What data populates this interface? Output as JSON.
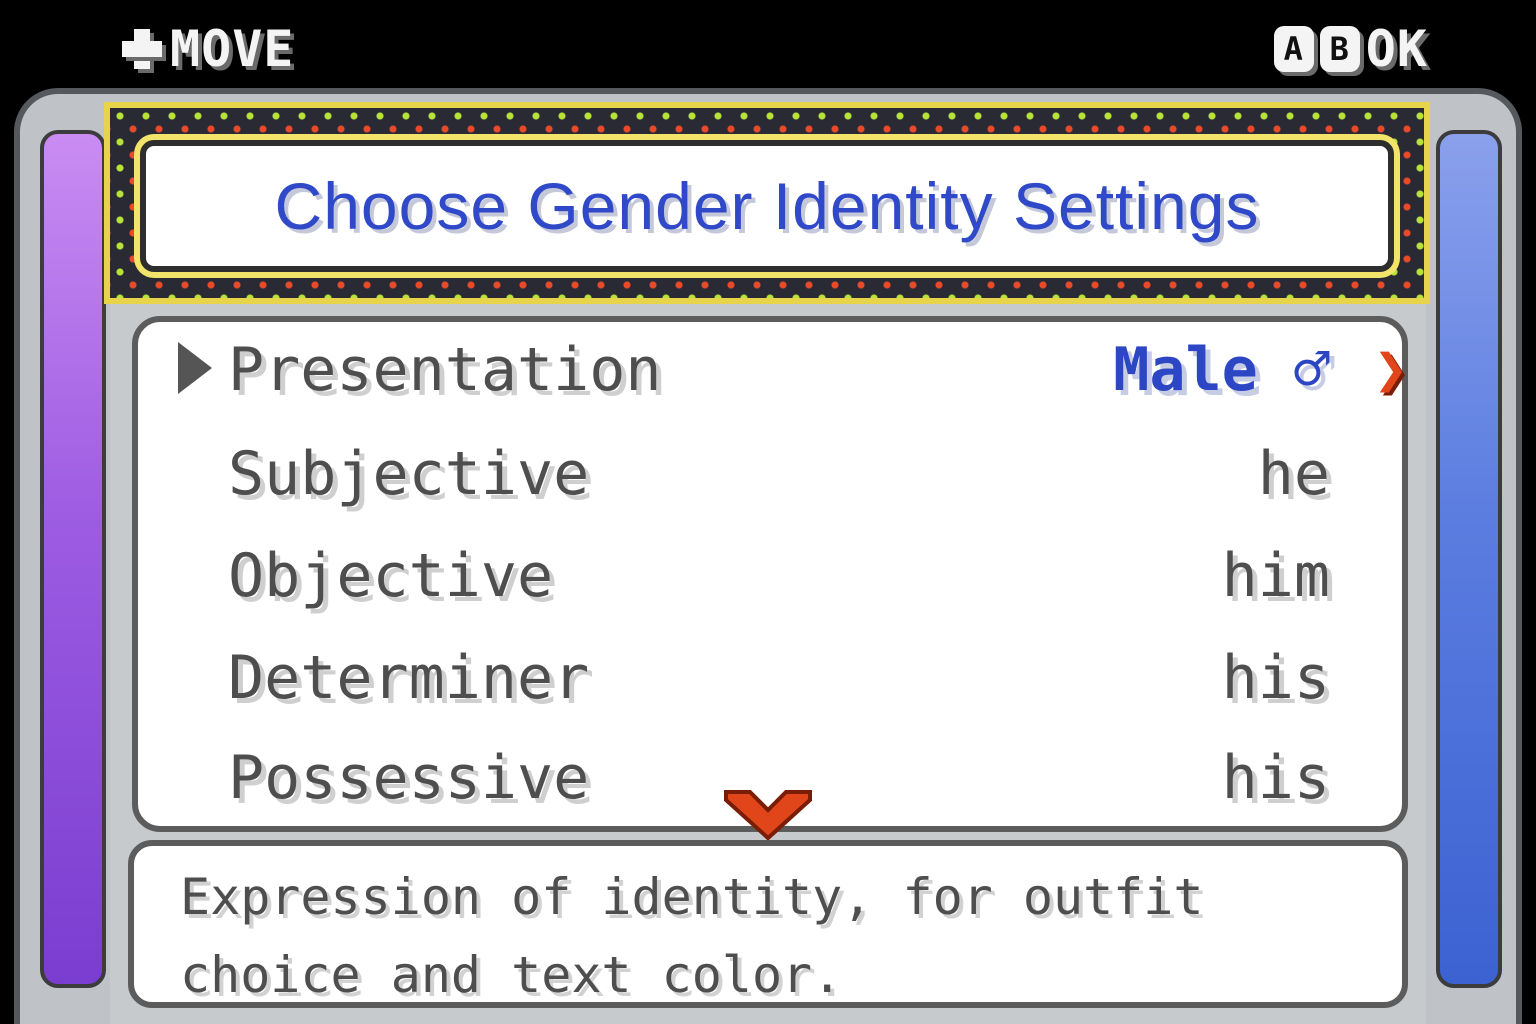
{
  "hints": {
    "move_label": "MOVE",
    "ok_label": "OK",
    "a_button": "A",
    "b_button": "B"
  },
  "title": "Choose Gender Identity Settings",
  "options": [
    {
      "label": "Presentation",
      "value": "Male ♂",
      "selected": true
    },
    {
      "label": "Subjective",
      "value": "he"
    },
    {
      "label": "Objective",
      "value": "him"
    },
    {
      "label": "Determiner",
      "value": "his"
    },
    {
      "label": "Possessive",
      "value": "his"
    }
  ],
  "description": {
    "line1": "Expression of identity, for outfit",
    "line2": "choice and text color."
  },
  "colors": {
    "selected_value": "#2d46c4",
    "title_text": "#2f49c8",
    "arrow": "#e0461a",
    "left_accent": "#9d5ce2",
    "right_accent": "#5b7de0"
  },
  "icons": [
    "dpad-icon",
    "a-button-icon",
    "b-button-icon",
    "cursor-arrow-icon",
    "chevron-right-icon",
    "chevron-down-icon"
  ]
}
